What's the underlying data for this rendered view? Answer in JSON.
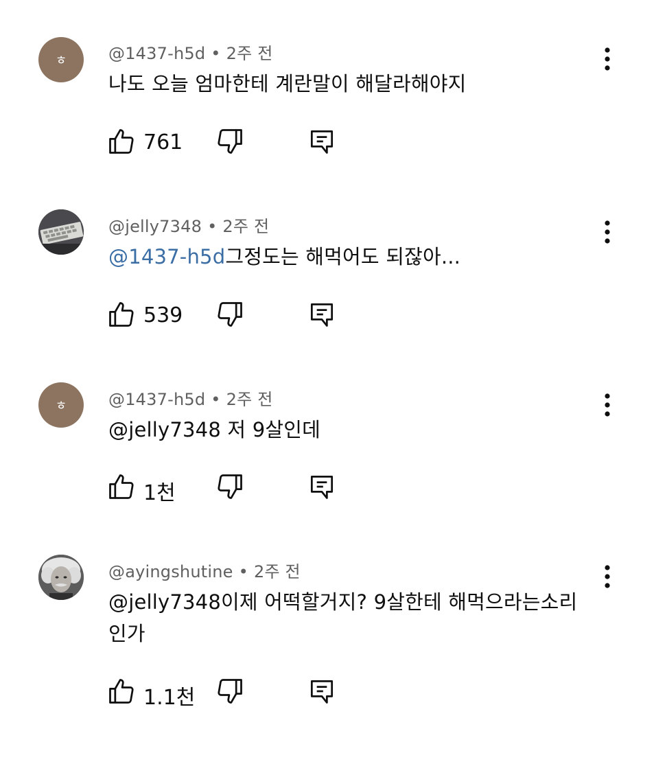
{
  "comments": [
    {
      "author": "@1437-h5d",
      "time": "2주 전",
      "avatar_letter": "ㅎ",
      "mention": "",
      "text": "나도 오늘 엄마한테 계란말이 해달라해야지",
      "likes": "761"
    },
    {
      "author": "@jelly7348",
      "time": "2주 전",
      "avatar_icon": "keyboard-photo-avatar",
      "mention": "@1437-h5d",
      "text": "그정도는 해먹어도 되잖아...",
      "likes": "539"
    },
    {
      "author": "@1437-h5d",
      "time": "2주 전",
      "avatar_letter": "ㅎ",
      "mention": "",
      "text": "@jelly7348 저 9살인데",
      "likes": "1천"
    },
    {
      "author": "@ayingshutine",
      "time": "2주 전",
      "avatar_icon": "einstein-photo-avatar",
      "mention": "",
      "text": "@jelly7348이제 어떡할거지? 9살한테 해먹으라는소리인가",
      "likes": "1.1천"
    }
  ],
  "separator": "•",
  "icons": [
    "like-icon",
    "dislike-icon",
    "reply-icon",
    "more-options-icon"
  ],
  "colors": {
    "mention": "#3b6ea5",
    "meta": "#606060",
    "avatar_letter_bg": "#8c7460"
  }
}
